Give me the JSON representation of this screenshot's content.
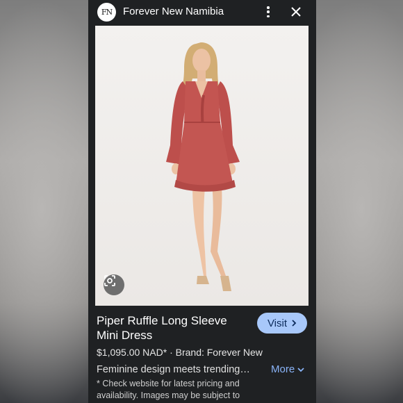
{
  "app": {
    "site_name": "Forever New Namibia",
    "logo_text": "FN"
  },
  "icons": {
    "logo": "forever-new-logo-icon",
    "menu": "more-vert-icon",
    "close": "close-icon",
    "lens": "google-lens-icon",
    "visit_chevron": "chevron-right-icon",
    "more_chevron": "chevron-down-icon"
  },
  "product": {
    "title_line1": "Piper Ruffle Long Sleeve",
    "title_line2": "Mini Dress",
    "price_brand": "$1,095.00 NAD* · Brand: Forever New",
    "description": "Feminine design meets trending…",
    "disclaimer_line1": "* Check website for latest pricing and",
    "disclaimer_line2": "availability. Images may be subject to"
  },
  "actions": {
    "visit_label": "Visit",
    "more_label": "More"
  },
  "colors": {
    "panel_bg": "#1f2123",
    "visit_bg": "#a8c8fa",
    "link": "#8ab4f8",
    "dress": "#c0514e"
  }
}
